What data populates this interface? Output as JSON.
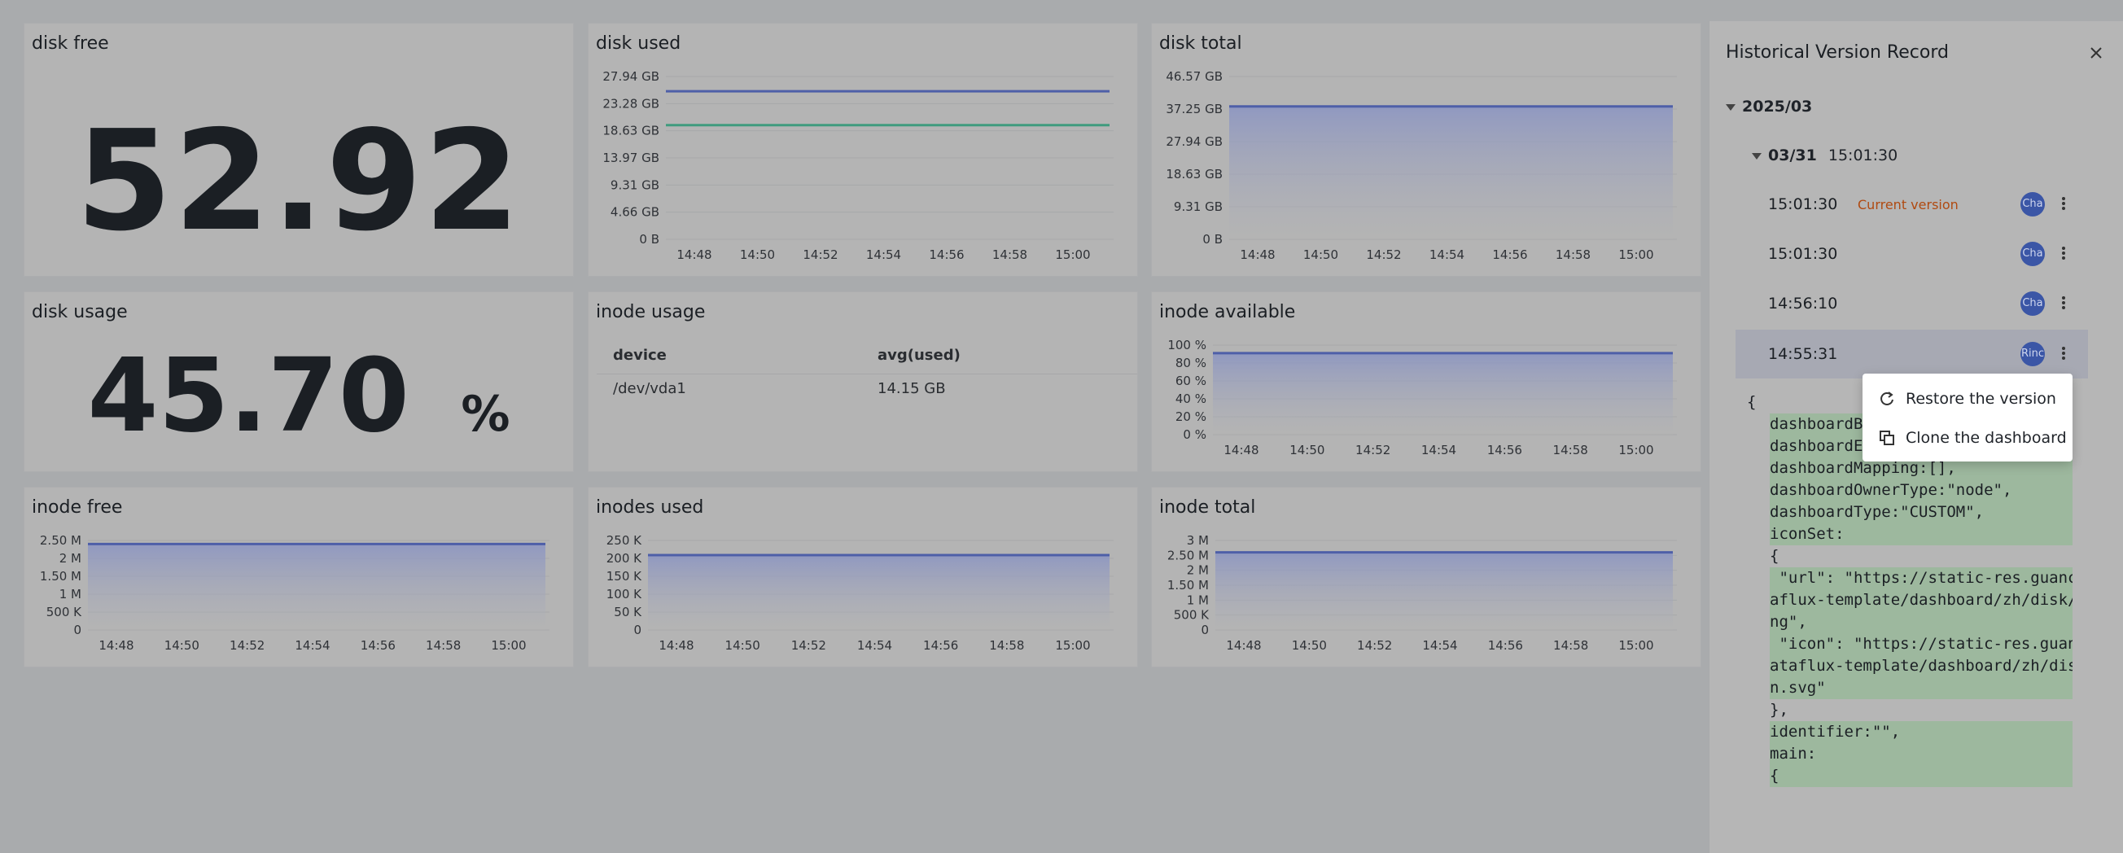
{
  "panels": {
    "disk_free": {
      "title": "disk free",
      "value": "52.92"
    },
    "disk_used": {
      "title": "disk used"
    },
    "disk_total": {
      "title": "disk total"
    },
    "disk_usage": {
      "title": "disk usage",
      "value": "45.70",
      "unit": "%"
    },
    "inode_usage": {
      "title": "inode usage",
      "columns": [
        "device",
        "avg(used)"
      ],
      "rows": [
        [
          "/dev/vda1",
          "14.15 GB"
        ]
      ]
    },
    "inode_available": {
      "title": "inode available"
    },
    "inode_free": {
      "title": "inode free"
    },
    "inodes_used": {
      "title": "inodes used"
    },
    "inode_total": {
      "title": "inode total"
    }
  },
  "chart_data": [
    {
      "id": "disk_used",
      "type": "line",
      "x": [
        "14:48",
        "14:50",
        "14:52",
        "14:54",
        "14:56",
        "14:58",
        "15:00"
      ],
      "y_ticks": [
        "27.94 GB",
        "23.28 GB",
        "18.63 GB",
        "13.97 GB",
        "9.31 GB",
        "4.66 GB",
        "0 B"
      ],
      "ylim": [
        0,
        27.94
      ],
      "series": [
        {
          "color": "#4e5fa8",
          "values": [
            25.4,
            25.4,
            25.4,
            25.4,
            25.4,
            25.4,
            25.4,
            25.4
          ]
        },
        {
          "color": "#3f9b7e",
          "values": [
            19.6,
            19.6,
            19.6,
            19.6,
            19.6,
            19.6,
            19.6,
            19.6
          ]
        }
      ]
    },
    {
      "id": "disk_total",
      "type": "area",
      "x": [
        "14:48",
        "14:50",
        "14:52",
        "14:54",
        "14:56",
        "14:58",
        "15:00"
      ],
      "y_ticks": [
        "46.57 GB",
        "37.25 GB",
        "27.94 GB",
        "18.63 GB",
        "9.31 GB",
        "0 B"
      ],
      "ylim": [
        0,
        46.57
      ],
      "series": [
        {
          "color": "#4e5fa8",
          "values": [
            38.0,
            38.0,
            38.0,
            38.0,
            38.0,
            38.0,
            38.0,
            38.0
          ]
        }
      ]
    },
    {
      "id": "inode_available",
      "type": "area",
      "x": [
        "14:48",
        "14:50",
        "14:52",
        "14:54",
        "14:56",
        "14:58",
        "15:00"
      ],
      "y_ticks": [
        "100 %",
        "80 %",
        "60 %",
        "40 %",
        "20 %",
        "0 %"
      ],
      "ylim": [
        0,
        100
      ],
      "series": [
        {
          "color": "#4e5fa8",
          "values": [
            91,
            91,
            91,
            91,
            91,
            91,
            91,
            91
          ]
        }
      ]
    },
    {
      "id": "inode_free",
      "type": "area",
      "x": [
        "14:48",
        "14:50",
        "14:52",
        "14:54",
        "14:56",
        "14:58",
        "15:00"
      ],
      "y_ticks": [
        "2.50 M",
        "2 M",
        "1.50 M",
        "1 M",
        "500 K",
        "0"
      ],
      "ylim": [
        0,
        2.5
      ],
      "series": [
        {
          "color": "#4e5fa8",
          "values": [
            2.4,
            2.4,
            2.4,
            2.4,
            2.4,
            2.4,
            2.4,
            2.4
          ]
        }
      ]
    },
    {
      "id": "inodes_used",
      "type": "area",
      "x": [
        "14:48",
        "14:50",
        "14:52",
        "14:54",
        "14:56",
        "14:58",
        "15:00"
      ],
      "y_ticks": [
        "250 K",
        "200 K",
        "150 K",
        "100 K",
        "50 K",
        "0"
      ],
      "ylim": [
        0,
        250
      ],
      "series": [
        {
          "color": "#4e5fa8",
          "values": [
            209,
            209,
            209,
            209,
            209,
            209,
            209,
            209
          ]
        }
      ]
    },
    {
      "id": "inode_total",
      "type": "area",
      "x": [
        "14:48",
        "14:50",
        "14:52",
        "14:54",
        "14:56",
        "14:58",
        "15:00"
      ],
      "y_ticks": [
        "3 M",
        "2.50 M",
        "2 M",
        "1.50 M",
        "1 M",
        "500 K",
        "0"
      ],
      "ylim": [
        0,
        3
      ],
      "series": [
        {
          "color": "#4e5fa8",
          "values": [
            2.6,
            2.6,
            2.6,
            2.6,
            2.6,
            2.6,
            2.6,
            2.6
          ]
        }
      ]
    }
  ],
  "drawer": {
    "title": "Historical Version Record",
    "month": "2025/03",
    "day_date": "03/31",
    "day_time": "15:01:30",
    "versions": [
      {
        "time": "15:01:30",
        "tag": "Current version",
        "author": "Cha"
      },
      {
        "time": "15:01:30",
        "tag": "",
        "author": "Cha"
      },
      {
        "time": "14:56:10",
        "tag": "",
        "author": "Cha"
      },
      {
        "time": "14:55:31",
        "tag": "",
        "author": "Rinc"
      }
    ],
    "code_lines": [
      {
        "text": "{",
        "hl": false
      },
      {
        "text": "dashboardB",
        "hl": true,
        "indent": 1
      },
      {
        "text": "dashboardE",
        "hl": true,
        "indent": 1
      },
      {
        "text": "dashboardMapping:[],",
        "hl": true,
        "indent": 1
      },
      {
        "text": "dashboardOwnerType:\"node\",",
        "hl": true,
        "indent": 1
      },
      {
        "text": "dashboardType:\"CUSTOM\",",
        "hl": true,
        "indent": 1
      },
      {
        "text": "iconSet:",
        "hl": true,
        "indent": 1
      },
      {
        "text": "{",
        "hl": false,
        "indent": 1
      },
      {
        "text": " \"url\": \"https://static-res.guance.com/dat",
        "hl": true,
        "indent": 1
      },
      {
        "text": "aflux-template/dashboard/zh/disk/disk.p",
        "hl": true,
        "indent": 1
      },
      {
        "text": "ng\",",
        "hl": true,
        "indent": 1
      },
      {
        "text": " \"icon\": \"https://static-res.guance.com/d",
        "hl": true,
        "indent": 1
      },
      {
        "text": "ataflux-template/dashboard/zh/disk/ico",
        "hl": true,
        "indent": 1
      },
      {
        "text": "n.svg\"",
        "hl": true,
        "indent": 1
      },
      {
        "text": "},",
        "hl": false,
        "indent": 1
      },
      {
        "text": "identifier:\"\",",
        "hl": true,
        "indent": 1
      },
      {
        "text": "main:",
        "hl": true,
        "indent": 1
      },
      {
        "text": "{",
        "hl": true,
        "indent": 1
      }
    ],
    "menu": {
      "restore": "Restore the version",
      "clone": "Clone the dashboard"
    }
  }
}
